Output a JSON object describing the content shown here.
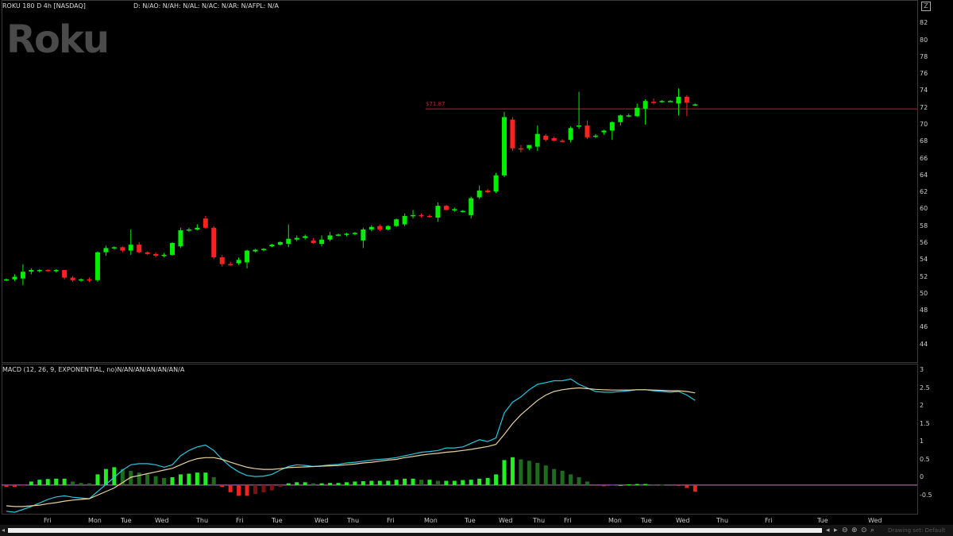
{
  "header": {
    "title": "ROKU 180 D 4h [NASDAQ]",
    "studies": "D: N/AO: N/AH: N/AL: N/AC: N/AR: N/AFPL: N/A",
    "logo": "Roku",
    "macd_title": "MACD (12, 26, 9, EXPONENTIAL, no)N/AN/AN/AN/AN/AN/A"
  },
  "price_line": {
    "label": "$71.87",
    "value": 71.87,
    "color": "#b0273a"
  },
  "colors": {
    "up": "#00ee00",
    "down": "#ff2020",
    "macd": "#29c6e0",
    "signal": "#e8d3a0",
    "zero": "#c080c0"
  },
  "footer": {
    "drawing_set": "Drawing set: Default",
    "scroll_left": "◂",
    "icons": [
      "◂",
      "▸",
      "⊖",
      "⊕",
      "⊙",
      "⌕"
    ]
  },
  "chart_data": [
    {
      "type": "candlestick",
      "title": "ROKU 180 D 4h [NASDAQ]",
      "ylim": [
        42,
        84
      ],
      "yticks": [
        44,
        46,
        48,
        50,
        52,
        54,
        56,
        58,
        60,
        62,
        64,
        66,
        68,
        70,
        72,
        74,
        76,
        78,
        80,
        82
      ],
      "xticks": [
        "Fri",
        "Mon",
        "Tue",
        "Wed",
        "Thu",
        "Fri",
        "Tue",
        "Wed",
        "Thu",
        "Fri",
        "Mon",
        "Tue",
        "Wed",
        "Thu",
        "Fri",
        "Mon",
        "Tue",
        "Wed",
        "Thu",
        "Fri",
        "Tue",
        "Wed"
      ],
      "candles": [
        {
          "o": 51.6,
          "h": 51.8,
          "l": 51.5,
          "c": 51.7
        },
        {
          "o": 51.7,
          "h": 52.3,
          "l": 51.5,
          "c": 52.0
        },
        {
          "o": 51.8,
          "h": 53.5,
          "l": 51.0,
          "c": 52.6
        },
        {
          "o": 52.6,
          "h": 53.0,
          "l": 52.3,
          "c": 52.8
        },
        {
          "o": 52.7,
          "h": 52.9,
          "l": 52.5,
          "c": 52.8
        },
        {
          "o": 52.8,
          "h": 52.9,
          "l": 52.6,
          "c": 52.7
        },
        {
          "o": 52.7,
          "h": 52.9,
          "l": 52.5,
          "c": 52.8
        },
        {
          "o": 52.8,
          "h": 52.8,
          "l": 51.7,
          "c": 51.9
        },
        {
          "o": 51.9,
          "h": 52.1,
          "l": 51.4,
          "c": 51.6
        },
        {
          "o": 51.6,
          "h": 51.8,
          "l": 51.4,
          "c": 51.7
        },
        {
          "o": 51.7,
          "h": 51.9,
          "l": 51.4,
          "c": 51.6
        },
        {
          "o": 51.6,
          "h": 55.0,
          "l": 51.4,
          "c": 54.9
        },
        {
          "o": 54.9,
          "h": 55.7,
          "l": 54.5,
          "c": 55.4
        },
        {
          "o": 55.4,
          "h": 55.6,
          "l": 55.2,
          "c": 55.5
        },
        {
          "o": 55.5,
          "h": 55.6,
          "l": 54.9,
          "c": 55.1
        },
        {
          "o": 55.1,
          "h": 57.6,
          "l": 54.6,
          "c": 55.8
        },
        {
          "o": 55.8,
          "h": 56.1,
          "l": 54.8,
          "c": 54.9
        },
        {
          "o": 54.9,
          "h": 55.0,
          "l": 54.6,
          "c": 54.7
        },
        {
          "o": 54.7,
          "h": 54.9,
          "l": 54.3,
          "c": 54.5
        },
        {
          "o": 54.5,
          "h": 54.8,
          "l": 54.3,
          "c": 54.6
        },
        {
          "o": 54.6,
          "h": 56.1,
          "l": 54.5,
          "c": 56.0
        },
        {
          "o": 55.6,
          "h": 57.8,
          "l": 55.4,
          "c": 57.5
        },
        {
          "o": 57.5,
          "h": 57.8,
          "l": 57.3,
          "c": 57.6
        },
        {
          "o": 57.6,
          "h": 58.2,
          "l": 57.5,
          "c": 57.8
        },
        {
          "o": 58.9,
          "h": 59.2,
          "l": 57.7,
          "c": 57.8
        },
        {
          "o": 57.8,
          "h": 58.0,
          "l": 54.1,
          "c": 54.3
        },
        {
          "o": 54.3,
          "h": 54.6,
          "l": 53.2,
          "c": 53.5
        },
        {
          "o": 53.5,
          "h": 53.8,
          "l": 53.3,
          "c": 53.4
        },
        {
          "o": 53.6,
          "h": 54.3,
          "l": 53.4,
          "c": 54.0
        },
        {
          "o": 53.7,
          "h": 55.2,
          "l": 53.0,
          "c": 55.1
        },
        {
          "o": 55.0,
          "h": 55.3,
          "l": 54.9,
          "c": 55.2
        },
        {
          "o": 55.2,
          "h": 55.4,
          "l": 55.0,
          "c": 55.3
        },
        {
          "o": 55.6,
          "h": 55.9,
          "l": 55.5,
          "c": 55.8
        },
        {
          "o": 55.8,
          "h": 56.2,
          "l": 55.7,
          "c": 56.1
        },
        {
          "o": 55.9,
          "h": 58.2,
          "l": 55.5,
          "c": 56.5
        },
        {
          "o": 56.4,
          "h": 56.9,
          "l": 56.2,
          "c": 56.6
        },
        {
          "o": 56.6,
          "h": 57.0,
          "l": 56.4,
          "c": 56.8
        },
        {
          "o": 56.3,
          "h": 56.6,
          "l": 55.9,
          "c": 56.0
        },
        {
          "o": 55.9,
          "h": 56.9,
          "l": 55.6,
          "c": 56.4
        },
        {
          "o": 56.4,
          "h": 57.3,
          "l": 56.2,
          "c": 56.9
        },
        {
          "o": 56.9,
          "h": 57.1,
          "l": 56.8,
          "c": 57.0
        },
        {
          "o": 57.0,
          "h": 57.2,
          "l": 56.8,
          "c": 57.1
        },
        {
          "o": 57.1,
          "h": 57.3,
          "l": 56.9,
          "c": 57.2
        },
        {
          "o": 56.3,
          "h": 57.8,
          "l": 55.4,
          "c": 57.6
        },
        {
          "o": 57.6,
          "h": 58.1,
          "l": 57.4,
          "c": 57.9
        },
        {
          "o": 58.0,
          "h": 58.2,
          "l": 57.4,
          "c": 57.6
        },
        {
          "o": 57.6,
          "h": 58.1,
          "l": 57.5,
          "c": 58.0
        },
        {
          "o": 58.0,
          "h": 58.9,
          "l": 57.9,
          "c": 58.8
        },
        {
          "o": 58.2,
          "h": 59.5,
          "l": 58.0,
          "c": 59.2
        },
        {
          "o": 59.2,
          "h": 59.9,
          "l": 58.9,
          "c": 59.3
        },
        {
          "o": 59.3,
          "h": 59.5,
          "l": 59.0,
          "c": 59.2
        },
        {
          "o": 59.2,
          "h": 59.4,
          "l": 59.0,
          "c": 59.1
        },
        {
          "o": 59.0,
          "h": 60.8,
          "l": 58.5,
          "c": 60.4
        },
        {
          "o": 60.4,
          "h": 60.5,
          "l": 59.9,
          "c": 59.9
        },
        {
          "o": 59.9,
          "h": 60.2,
          "l": 59.7,
          "c": 60.0
        },
        {
          "o": 59.7,
          "h": 59.9,
          "l": 59.6,
          "c": 59.8
        },
        {
          "o": 59.3,
          "h": 61.5,
          "l": 58.9,
          "c": 61.3
        },
        {
          "o": 61.4,
          "h": 62.8,
          "l": 61.2,
          "c": 62.2
        },
        {
          "o": 62.2,
          "h": 62.4,
          "l": 61.9,
          "c": 62.0
        },
        {
          "o": 62.1,
          "h": 64.3,
          "l": 61.9,
          "c": 64.0
        },
        {
          "o": 64.0,
          "h": 71.5,
          "l": 63.8,
          "c": 70.9
        },
        {
          "o": 70.6,
          "h": 70.9,
          "l": 66.9,
          "c": 67.2
        },
        {
          "o": 67.2,
          "h": 67.6,
          "l": 66.7,
          "c": 67.1
        },
        {
          "o": 67.2,
          "h": 67.6,
          "l": 67.0,
          "c": 67.6
        },
        {
          "o": 67.4,
          "h": 69.9,
          "l": 66.9,
          "c": 68.9
        },
        {
          "o": 68.7,
          "h": 68.9,
          "l": 68.0,
          "c": 68.2
        },
        {
          "o": 68.4,
          "h": 68.6,
          "l": 68.0,
          "c": 68.1
        },
        {
          "o": 68.1,
          "h": 68.3,
          "l": 67.9,
          "c": 68.0
        },
        {
          "o": 68.2,
          "h": 69.8,
          "l": 67.9,
          "c": 69.6
        },
        {
          "o": 69.8,
          "h": 73.9,
          "l": 69.5,
          "c": 69.9
        },
        {
          "o": 69.9,
          "h": 70.5,
          "l": 68.3,
          "c": 68.5
        },
        {
          "o": 68.6,
          "h": 68.9,
          "l": 68.4,
          "c": 68.7
        },
        {
          "o": 69.1,
          "h": 69.4,
          "l": 68.8,
          "c": 69.3
        },
        {
          "o": 69.3,
          "h": 70.4,
          "l": 68.2,
          "c": 70.3
        },
        {
          "o": 70.3,
          "h": 71.2,
          "l": 69.9,
          "c": 71.1
        },
        {
          "o": 71.0,
          "h": 71.3,
          "l": 70.9,
          "c": 71.1
        },
        {
          "o": 71.0,
          "h": 72.5,
          "l": 70.9,
          "c": 72.0
        },
        {
          "o": 71.9,
          "h": 73.0,
          "l": 70.0,
          "c": 72.8
        },
        {
          "o": 72.7,
          "h": 73.1,
          "l": 72.4,
          "c": 72.6
        },
        {
          "o": 72.7,
          "h": 72.9,
          "l": 72.6,
          "c": 72.8
        },
        {
          "o": 72.8,
          "h": 72.9,
          "l": 72.7,
          "c": 72.8
        },
        {
          "o": 72.5,
          "h": 74.3,
          "l": 71.1,
          "c": 73.3
        },
        {
          "o": 73.3,
          "h": 73.5,
          "l": 71.0,
          "c": 72.6
        },
        {
          "o": 72.4,
          "h": 72.5,
          "l": 72.3,
          "c": 72.4
        }
      ]
    },
    {
      "type": "macd",
      "title": "MACD (12, 26, 9, EXPONENTIAL, no)",
      "ylim": [
        -1.0,
        3.0
      ],
      "yticks": [
        -0.5,
        0,
        0.5,
        1,
        1.5,
        2,
        2.5,
        3
      ],
      "series": [
        {
          "name": "MACD",
          "values": [
            -0.95,
            -0.98,
            -0.9,
            -0.82,
            -0.72,
            -0.62,
            -0.55,
            -0.52,
            -0.56,
            -0.58,
            -0.6,
            -0.4,
            -0.2,
            -0.0,
            0.2,
            0.35,
            0.38,
            0.38,
            0.35,
            0.28,
            0.35,
            0.6,
            0.75,
            0.85,
            0.9,
            0.75,
            0.5,
            0.3,
            0.15,
            0.05,
            0.02,
            0.03,
            0.08,
            0.2,
            0.3,
            0.35,
            0.33,
            0.3,
            0.32,
            0.35,
            0.36,
            0.4,
            0.42,
            0.45,
            0.48,
            0.5,
            0.52,
            0.55,
            0.6,
            0.65,
            0.7,
            0.72,
            0.75,
            0.82,
            0.82,
            0.85,
            0.95,
            1.05,
            1.0,
            1.1,
            1.8,
            2.1,
            2.25,
            2.45,
            2.6,
            2.65,
            2.7,
            2.7,
            2.75,
            2.6,
            2.5,
            2.4,
            2.38,
            2.38,
            2.4,
            2.42,
            2.45,
            2.45,
            2.42,
            2.4,
            2.38,
            2.4,
            2.3,
            2.15
          ]
        },
        {
          "name": "Signal",
          "values": [
            -0.8,
            -0.82,
            -0.82,
            -0.8,
            -0.78,
            -0.74,
            -0.71,
            -0.67,
            -0.64,
            -0.62,
            -0.6,
            -0.5,
            -0.4,
            -0.3,
            -0.15,
            -0.0,
            0.05,
            0.1,
            0.15,
            0.2,
            0.25,
            0.35,
            0.45,
            0.52,
            0.55,
            0.55,
            0.5,
            0.42,
            0.35,
            0.28,
            0.24,
            0.22,
            0.22,
            0.24,
            0.27,
            0.28,
            0.29,
            0.3,
            0.31,
            0.32,
            0.33,
            0.35,
            0.37,
            0.4,
            0.42,
            0.45,
            0.48,
            0.5,
            0.55,
            0.58,
            0.62,
            0.65,
            0.67,
            0.7,
            0.72,
            0.75,
            0.78,
            0.82,
            0.86,
            0.92,
            1.2,
            1.5,
            1.75,
            1.95,
            2.15,
            2.3,
            2.4,
            2.45,
            2.48,
            2.5,
            2.48,
            2.46,
            2.45,
            2.44,
            2.44,
            2.44,
            2.45,
            2.45,
            2.44,
            2.43,
            2.42,
            2.42,
            2.4,
            2.36
          ]
        }
      ],
      "histogram": [
        -0.05,
        -0.05,
        -0.03,
        0.1,
        0.15,
        0.17,
        0.18,
        0.18,
        0.1,
        0.06,
        0.05,
        0.3,
        0.45,
        0.5,
        0.45,
        0.4,
        0.35,
        0.3,
        0.25,
        0.2,
        0.22,
        0.3,
        0.32,
        0.35,
        0.35,
        0.22,
        -0.05,
        -0.2,
        -0.3,
        -0.3,
        -0.25,
        -0.2,
        -0.15,
        -0.05,
        0.05,
        0.08,
        0.08,
        0.05,
        0.05,
        0.06,
        0.06,
        0.08,
        0.1,
        0.11,
        0.12,
        0.12,
        0.12,
        0.15,
        0.18,
        0.18,
        0.15,
        0.15,
        0.12,
        0.12,
        0.12,
        0.14,
        0.15,
        0.18,
        0.2,
        0.3,
        0.7,
        0.78,
        0.72,
        0.68,
        0.62,
        0.55,
        0.45,
        0.4,
        0.3,
        0.22,
        0.1,
        0.0,
        -0.03,
        -0.02,
        0.0,
        0.02,
        0.03,
        0.03,
        0.02,
        0.01,
        0.0,
        -0.02,
        -0.08,
        -0.18
      ]
    }
  ]
}
